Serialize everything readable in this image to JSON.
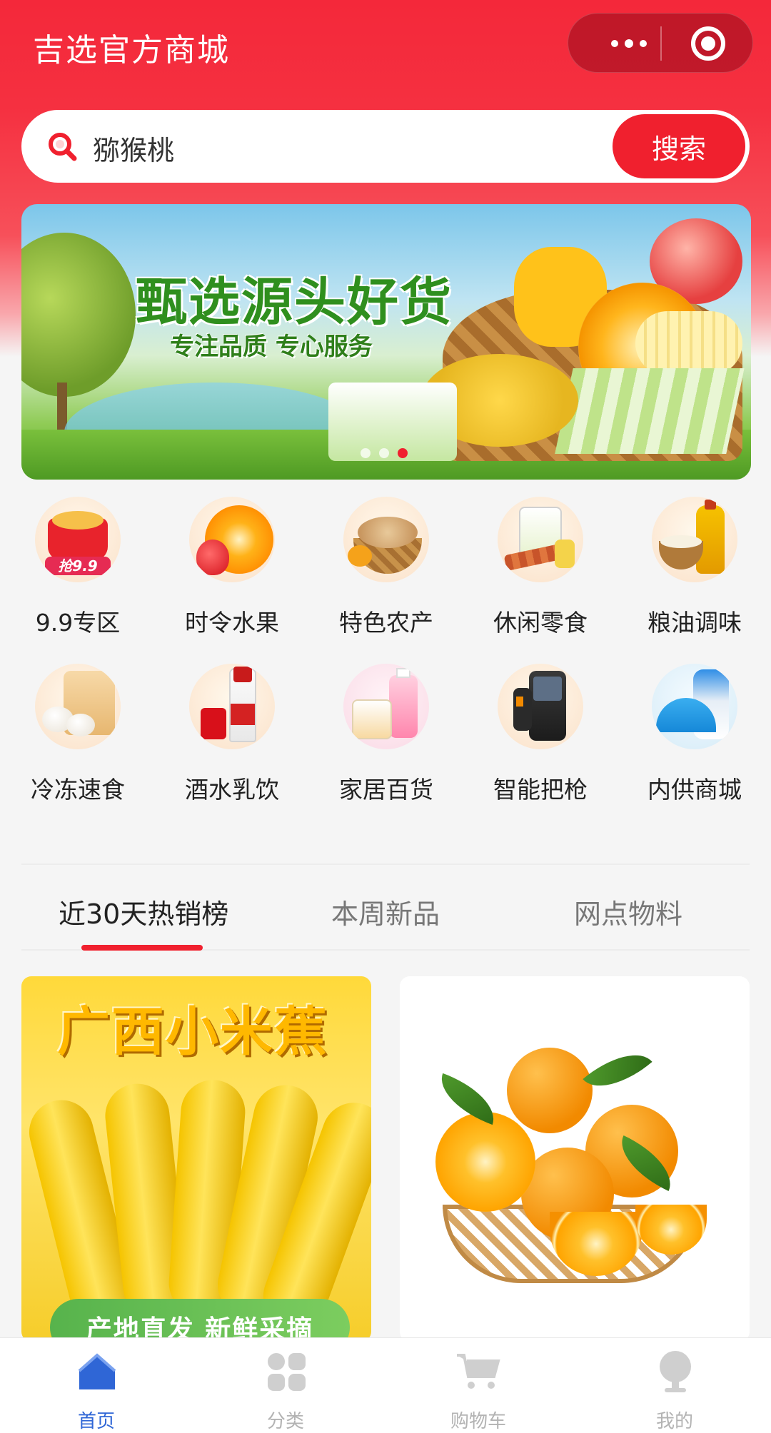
{
  "header": {
    "title": "吉选官方商城"
  },
  "search": {
    "query": "猕猴桃",
    "button_label": "搜索"
  },
  "banner": {
    "headline": "甄选源头好货",
    "subline": "专注品质 专心服务",
    "dots_count": 3,
    "active_dot": 3
  },
  "categories": [
    {
      "label": "9.9专区",
      "icon": "red-envelope-icon",
      "badge": "抢9.9"
    },
    {
      "label": "时令水果",
      "icon": "orange-fruit-icon"
    },
    {
      "label": "特色农产",
      "icon": "nuts-basket-icon"
    },
    {
      "label": "休闲零食",
      "icon": "snack-pack-icon"
    },
    {
      "label": "粮油调味",
      "icon": "oil-rice-icon"
    },
    {
      "label": "冷冻速食",
      "icon": "frozen-buns-icon"
    },
    {
      "label": "酒水乳饮",
      "icon": "liquor-bottle-icon"
    },
    {
      "label": "家居百货",
      "icon": "household-icon"
    },
    {
      "label": "智能把枪",
      "icon": "handheld-scanner-icon"
    },
    {
      "label": "内供商城",
      "icon": "umbrella-thermos-icon"
    }
  ],
  "tabs": [
    {
      "label": "近30天热销榜",
      "active": true
    },
    {
      "label": "本周新品",
      "active": false
    },
    {
      "label": "网点物料",
      "active": false
    }
  ],
  "products": [
    {
      "title": "广西小米蕉",
      "tag": "产地直发 新鲜采摘",
      "image": "banana"
    },
    {
      "image": "oranges-basket"
    }
  ],
  "bottom_nav": [
    {
      "label": "首页",
      "icon": "home-icon",
      "active": true
    },
    {
      "label": "分类",
      "icon": "grid-icon",
      "active": false
    },
    {
      "label": "购物车",
      "icon": "cart-icon",
      "active": false
    },
    {
      "label": "我的",
      "icon": "profile-icon",
      "active": false
    }
  ],
  "colors": {
    "brand_red": "#f0202e",
    "nav_active": "#2f66d6"
  }
}
